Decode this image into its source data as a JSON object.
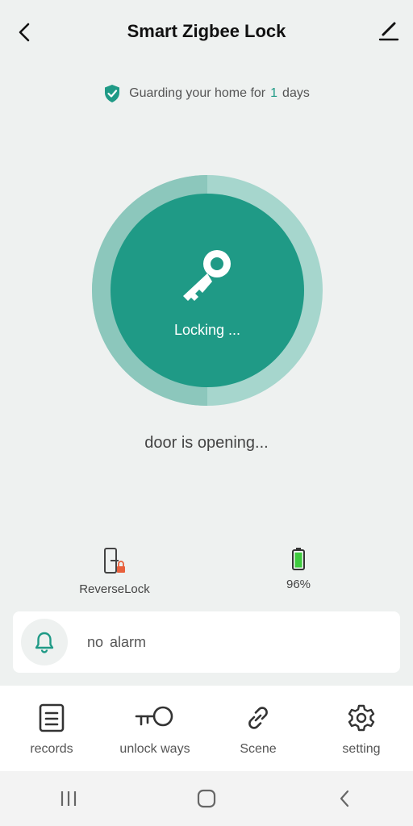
{
  "header": {
    "title": "Smart Zigbee Lock"
  },
  "guard": {
    "prefix": "Guarding your home for",
    "days": "1",
    "suffix": "days"
  },
  "lock": {
    "status": "Locking ...",
    "door_status": "door is opening..."
  },
  "status_row": {
    "mode_label": "ReverseLock",
    "battery_label": "96%"
  },
  "alarm": {
    "text": "no alarm"
  },
  "tabs": [
    {
      "label": "records",
      "icon": "records-icon"
    },
    {
      "label": "unlock ways",
      "icon": "key-icon"
    },
    {
      "label": "Scene",
      "icon": "link-icon"
    },
    {
      "label": "setting",
      "icon": "gear-icon"
    }
  ],
  "colors": {
    "accent": "#1f9a86",
    "ring": "#9fd1c8",
    "ring_dark": "#7fbfb4"
  }
}
